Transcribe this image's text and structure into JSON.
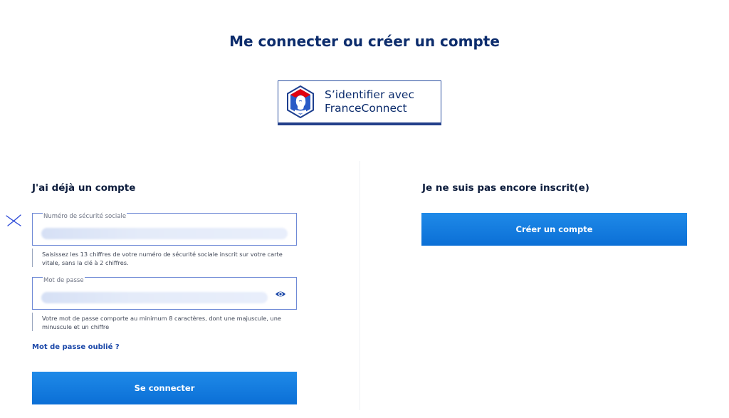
{
  "page": {
    "title": "Me connecter ou créer un compte"
  },
  "franceconnect": {
    "line1": "S’identifier avec",
    "line2": "FranceConnect"
  },
  "login": {
    "title": "J'ai déjà un compte",
    "nss_label": "Numéro de sécurité sociale",
    "nss_hint": "Saisissez les 13 chiffres de votre numéro de sécurité sociale inscrit sur votre carte vitale, sans la clé à 2 chiffres.",
    "password_label": "Mot de passe",
    "password_hint": "Votre mot de passe comporte au minimum 8 caractères, dont une majuscule, une minuscule et un chiffre",
    "forgot_link": "Mot de passe oublié ?",
    "submit_label": "Se connecter"
  },
  "register": {
    "title": "Je ne suis pas encore inscrit(e)",
    "create_label": "Créer un compte"
  },
  "colors": {
    "primary": "#0b6fd6",
    "title": "#0c2c6c",
    "field_border": "#6f8ad6"
  }
}
